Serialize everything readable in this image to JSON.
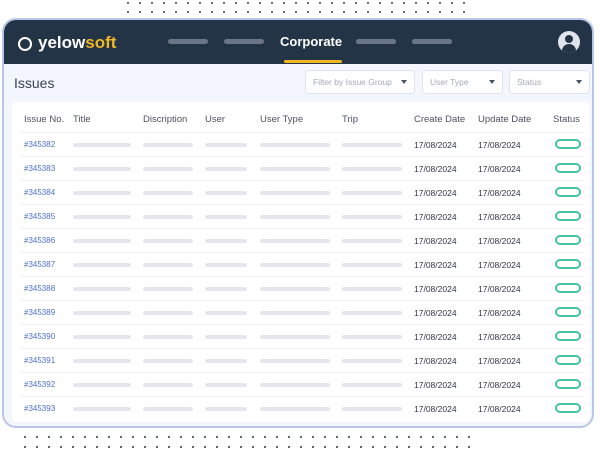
{
  "app": {
    "logo_prefix": "yelow",
    "logo_suffix": "soft"
  },
  "nav": {
    "active_label": "Corporate"
  },
  "page": {
    "title": "Issues"
  },
  "filters": [
    {
      "placeholder": "Filter by Issue Group"
    },
    {
      "placeholder": "User Type"
    },
    {
      "placeholder": "Status"
    }
  ],
  "table": {
    "headers": [
      "Issue No.",
      "Title",
      "Discription",
      "User",
      "User Type",
      "Trip",
      "Create Date",
      "Update Date",
      "Status"
    ],
    "rows": [
      {
        "id": "#345382",
        "create": "17/08/2024",
        "update": "17/08/2024"
      },
      {
        "id": "#345383",
        "create": "17/08/2024",
        "update": "17/08/2024"
      },
      {
        "id": "#345384",
        "create": "17/08/2024",
        "update": "17/08/2024"
      },
      {
        "id": "#345385",
        "create": "17/08/2024",
        "update": "17/08/2024"
      },
      {
        "id": "#345386",
        "create": "17/08/2024",
        "update": "17/08/2024"
      },
      {
        "id": "#345387",
        "create": "17/08/2024",
        "update": "17/08/2024"
      },
      {
        "id": "#345388",
        "create": "17/08/2024",
        "update": "17/08/2024"
      },
      {
        "id": "#345389",
        "create": "17/08/2024",
        "update": "17/08/2024"
      },
      {
        "id": "#345390",
        "create": "17/08/2024",
        "update": "17/08/2024"
      },
      {
        "id": "#345391",
        "create": "17/08/2024",
        "update": "17/08/2024"
      },
      {
        "id": "#345392",
        "create": "17/08/2024",
        "update": "17/08/2024"
      },
      {
        "id": "#345393",
        "create": "17/08/2024",
        "update": "17/08/2024"
      }
    ]
  },
  "colors": {
    "header_bg": "#243447",
    "accent": "#f2b624",
    "link": "#4c6fd1",
    "status": "#43c6a5"
  }
}
